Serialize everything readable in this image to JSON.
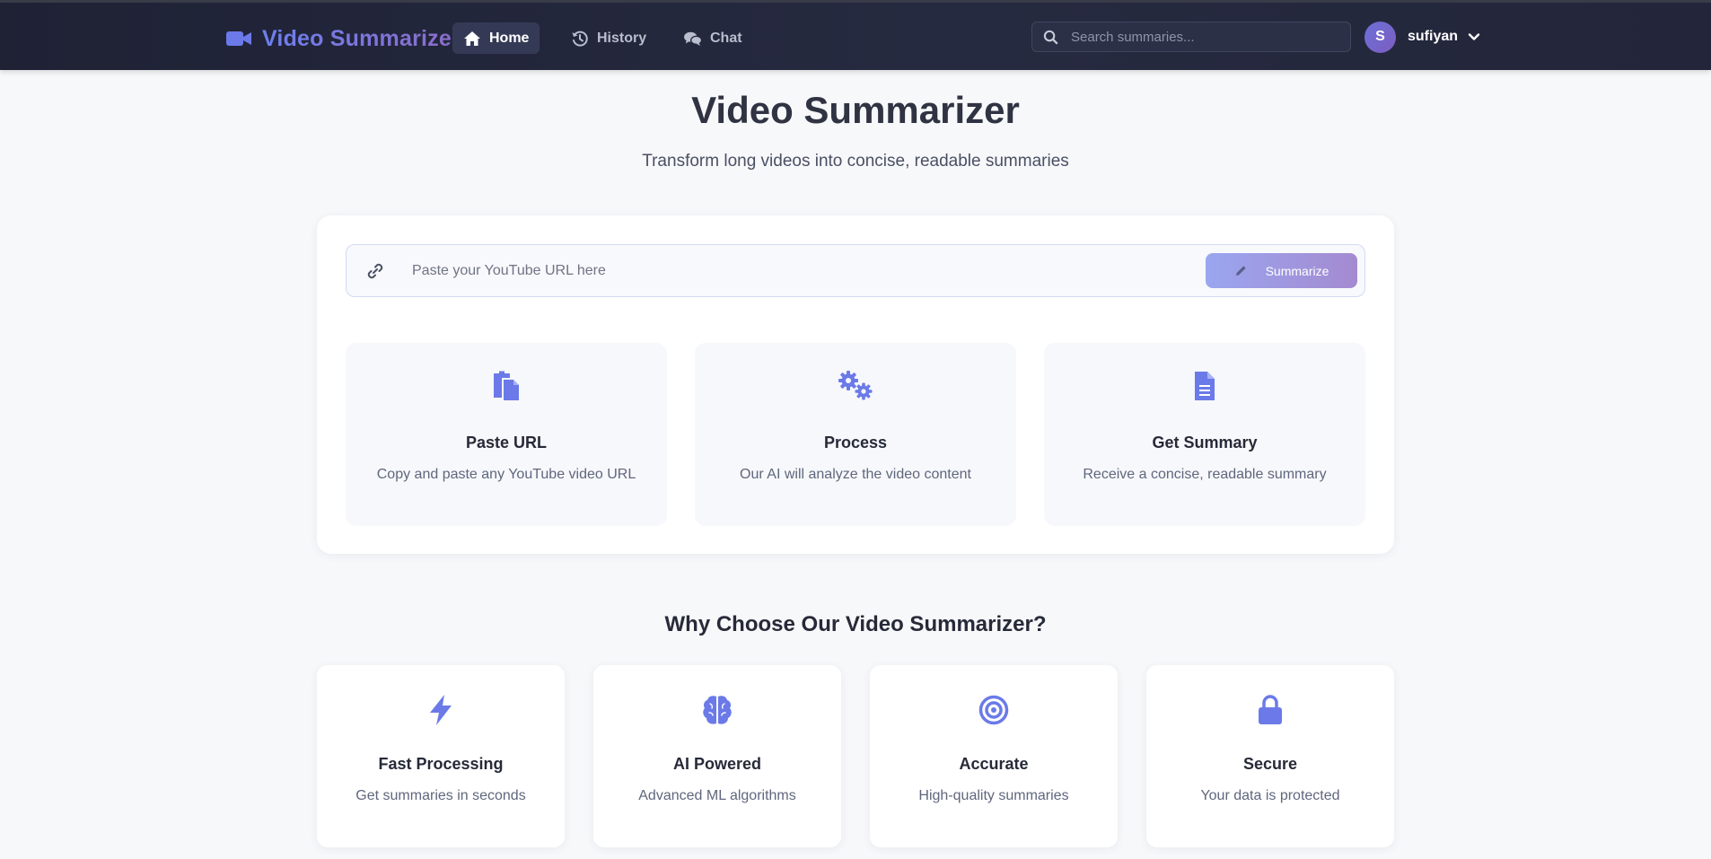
{
  "colors": {
    "accent": "#6b7ae8",
    "nav_bg": "#23263a",
    "page_bg": "#f7f8fa"
  },
  "brand": {
    "name": "Video Summarizer",
    "icon": "video-camera-icon"
  },
  "nav": {
    "items": [
      {
        "label": "Home",
        "icon": "home-icon",
        "active": true
      },
      {
        "label": "History",
        "icon": "history-icon",
        "active": false
      },
      {
        "label": "Chat",
        "icon": "chat-icon",
        "active": false
      }
    ]
  },
  "search": {
    "placeholder": "Search summaries...",
    "value": ""
  },
  "user": {
    "initial": "S",
    "name": "sufiyan"
  },
  "hero": {
    "title": "Video Summarizer",
    "subtitle": "Transform long videos into concise, readable summaries"
  },
  "url_form": {
    "placeholder": "Paste your YouTube URL here",
    "value": "",
    "button_label": "Summarize"
  },
  "steps": [
    {
      "title": "Paste URL",
      "description": "Copy and paste any YouTube video URL",
      "icon": "clipboard-icon"
    },
    {
      "title": "Process",
      "description": "Our AI will analyze the video content",
      "icon": "gears-icon"
    },
    {
      "title": "Get Summary",
      "description": "Receive a concise, readable summary",
      "icon": "document-icon"
    }
  ],
  "why": {
    "title": "Why Choose Our Video Summarizer?",
    "features": [
      {
        "title": "Fast Processing",
        "description": "Get summaries in seconds",
        "icon": "bolt-icon"
      },
      {
        "title": "AI Powered",
        "description": "Advanced ML algorithms",
        "icon": "brain-icon"
      },
      {
        "title": "Accurate",
        "description": "High-quality summaries",
        "icon": "target-icon"
      },
      {
        "title": "Secure",
        "description": "Your data is protected",
        "icon": "lock-icon"
      }
    ]
  }
}
